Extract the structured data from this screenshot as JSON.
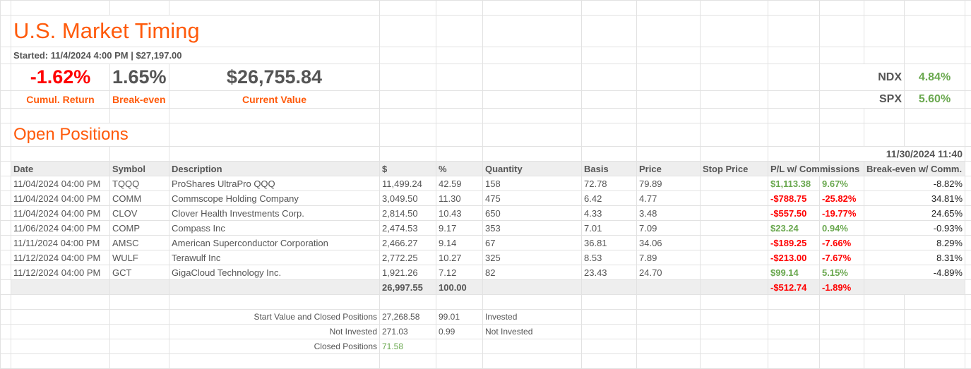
{
  "title": "U.S. Market Timing",
  "started": "Started: 11/4/2024 4:00 PM | $27,197.00",
  "summary": {
    "cumul_return": "-1.62%",
    "cumul_label": "Cumul. Return",
    "breakeven": "1.65%",
    "breakeven_label": "Break-even",
    "current_value": "$26,755.84",
    "current_label": "Current Value"
  },
  "indices": [
    {
      "name": "NDX",
      "value": "4.84%"
    },
    {
      "name": "SPX",
      "value": "5.60%"
    }
  ],
  "section": "Open Positions",
  "timestamp": "11/30/2024 11:40",
  "headers": [
    "Date",
    "Symbol",
    "Description",
    "$",
    "%",
    "Quantity",
    "Basis",
    "Price",
    "Stop Price",
    "P/L w/ Commissions",
    "Break-even w/ Comm."
  ],
  "rows": [
    {
      "date": "11/04/2024 04:00 PM",
      "symbol": "TQQQ",
      "desc": "ProShares UltraPro QQQ",
      "amt": "11,499.24",
      "pct": "42.59",
      "qty": "158",
      "basis": "72.78",
      "price": "79.89",
      "stop": "",
      "pl": "$1,113.38",
      "plpct": "9.67%",
      "be": "-8.82%",
      "pos": true
    },
    {
      "date": "11/04/2024 04:00 PM",
      "symbol": "COMM",
      "desc": "Commscope Holding Company",
      "amt": "3,049.50",
      "pct": "11.30",
      "qty": "475",
      "basis": "6.42",
      "price": "4.77",
      "stop": "",
      "pl": "-$788.75",
      "plpct": "-25.82%",
      "be": "34.81%",
      "pos": false
    },
    {
      "date": "11/04/2024 04:00 PM",
      "symbol": "CLOV",
      "desc": "Clover Health Investments Corp.",
      "amt": "2,814.50",
      "pct": "10.43",
      "qty": "650",
      "basis": "4.33",
      "price": "3.48",
      "stop": "",
      "pl": "-$557.50",
      "plpct": "-19.77%",
      "be": "24.65%",
      "pos": false
    },
    {
      "date": "11/06/2024 04:00 PM",
      "symbol": "COMP",
      "desc": "Compass Inc",
      "amt": "2,474.53",
      "pct": "9.17",
      "qty": "353",
      "basis": "7.01",
      "price": "7.09",
      "stop": "",
      "pl": "$23.24",
      "plpct": "0.94%",
      "be": "-0.93%",
      "pos": true
    },
    {
      "date": "11/11/2024 04:00 PM",
      "symbol": "AMSC",
      "desc": "American Superconductor Corporation",
      "amt": "2,466.27",
      "pct": "9.14",
      "qty": "67",
      "basis": "36.81",
      "price": "34.06",
      "stop": "",
      "pl": "-$189.25",
      "plpct": "-7.66%",
      "be": "8.29%",
      "pos": false
    },
    {
      "date": "11/12/2024 04:00 PM",
      "symbol": "WULF",
      "desc": "Terawulf Inc",
      "amt": "2,772.25",
      "pct": "10.27",
      "qty": "325",
      "basis": "8.53",
      "price": "7.89",
      "stop": "",
      "pl": "-$213.00",
      "plpct": "-7.67%",
      "be": "8.31%",
      "pos": false
    },
    {
      "date": "11/12/2024 04:00 PM",
      "symbol": "GCT",
      "desc": "GigaCloud Technology Inc.",
      "amt": "1,921.26",
      "pct": "7.12",
      "qty": "82",
      "basis": "23.43",
      "price": "24.70",
      "stop": "",
      "pl": "$99.14",
      "plpct": "5.15%",
      "be": "-4.89%",
      "pos": true
    }
  ],
  "totals": {
    "amt": "26,997.55",
    "pct": "100.00",
    "pl": "-$512.74",
    "plpct": "-1.89%"
  },
  "footer": [
    {
      "label": "Start Value and Closed Positions",
      "value": "27,268.58",
      "pct": "99.01",
      "note": "Invested"
    },
    {
      "label": "Not Invested",
      "value": "271.03",
      "pct": "0.99",
      "note": "Not Invested"
    },
    {
      "label": "Closed Positions",
      "value": "71.58",
      "pct": "",
      "note": ""
    }
  ],
  "colors": {
    "accent": "#ff5a0a",
    "positive": "#6aa84f",
    "negative": "#ff0000"
  }
}
